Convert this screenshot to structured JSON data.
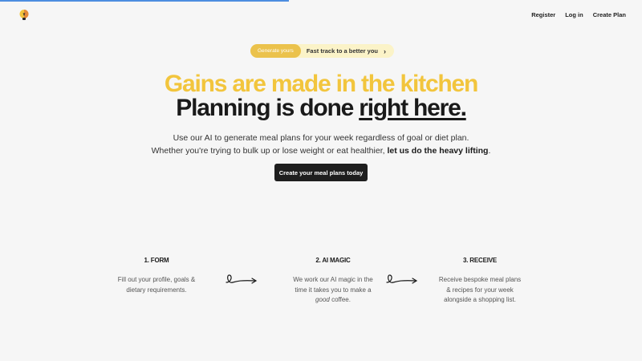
{
  "progress": {
    "fraction": 0.45
  },
  "brand": {
    "logo_icon": "lightbulb-logo-icon"
  },
  "nav": {
    "register": "Register",
    "login": "Log in",
    "create_plan": "Create Plan"
  },
  "pill": {
    "badge": "Generate yours",
    "text": "Fast track to a better you",
    "chevron": "›"
  },
  "hero": {
    "headline_1": "Gains are made in the kitchen",
    "headline_2_prefix": "Planning is done ",
    "headline_2_underline": "right here.",
    "desc_line_1": "Use our AI to generate meal plans for your week regardless of goal or diet plan.",
    "desc_line_2_prefix": "Whether you're trying to bulk up or lose weight or eat healthier, ",
    "desc_line_2_bold": "let us do the heavy lifting",
    "desc_line_2_suffix": ".",
    "cta": "Create your meal plans today"
  },
  "steps": [
    {
      "title": "1. FORM",
      "line_1": "Fill out your profile, goals &",
      "line_2": "dietary requirements."
    },
    {
      "title": "2. AI MAGIC",
      "line_1": "We work our AI magic in the",
      "line_2": "time it takes you to make a",
      "line_3_prefix": "",
      "line_3_italic": "good",
      "line_3_suffix": " coffee."
    },
    {
      "title": "3. RECEIVE",
      "line_1": "Receive bespoke meal plans",
      "line_2": "& recipes for your week",
      "line_3": "alongside a shopping list."
    }
  ],
  "colors": {
    "accent_yellow": "#f2c53d",
    "dark": "#1e1e1e",
    "progress_blue": "#4d8de0"
  }
}
